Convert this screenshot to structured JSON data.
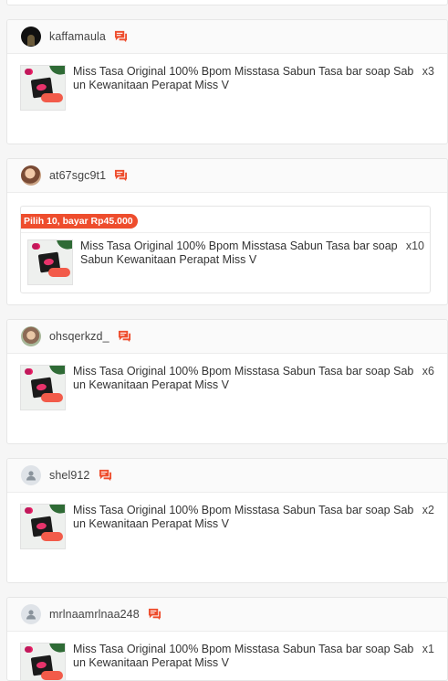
{
  "colors": {
    "accent": "#ee4d2d",
    "chat_icon": "#ee4d2d"
  },
  "orders": [
    {
      "username": "kaffamaula",
      "avatar": "avatar-photo-dark",
      "items": [
        {
          "name": "Miss Tasa Original 100% Bpom Misstasa Sabun Tasa bar soap Sabun Kewanitaan Perapat Miss V",
          "qty": "x3"
        }
      ]
    },
    {
      "username": "at67sgc9t1",
      "avatar": "avatar-photo",
      "bundle_label": "Pilih 10, bayar Rp45.000",
      "items": [
        {
          "name": "Miss Tasa Original 100% Bpom Misstasa Sabun Tasa bar soap Sabun Kewanitaan Perapat Miss V",
          "qty": "x10"
        }
      ]
    },
    {
      "username": "ohsqerkzd_",
      "avatar": "avatar-photo",
      "items": [
        {
          "name": "Miss Tasa Original 100% Bpom Misstasa Sabun Tasa bar soap Sabun Kewanitaan Perapat Miss V",
          "qty": "x6"
        }
      ]
    },
    {
      "username": "shel912",
      "avatar": "avatar-default-user-icon",
      "items": [
        {
          "name": "Miss Tasa Original 100% Bpom Misstasa Sabun Tasa bar soap Sabun Kewanitaan Perapat Miss V",
          "qty": "x2"
        }
      ]
    },
    {
      "username": "mrlnaamrlnaa248",
      "avatar": "avatar-default-user-icon",
      "items": [
        {
          "name": "Miss Tasa Original 100% Bpom Misstasa Sabun Tasa bar soap Sabun Kewanitaan Perapat Miss V",
          "qty": "x1"
        }
      ]
    }
  ]
}
